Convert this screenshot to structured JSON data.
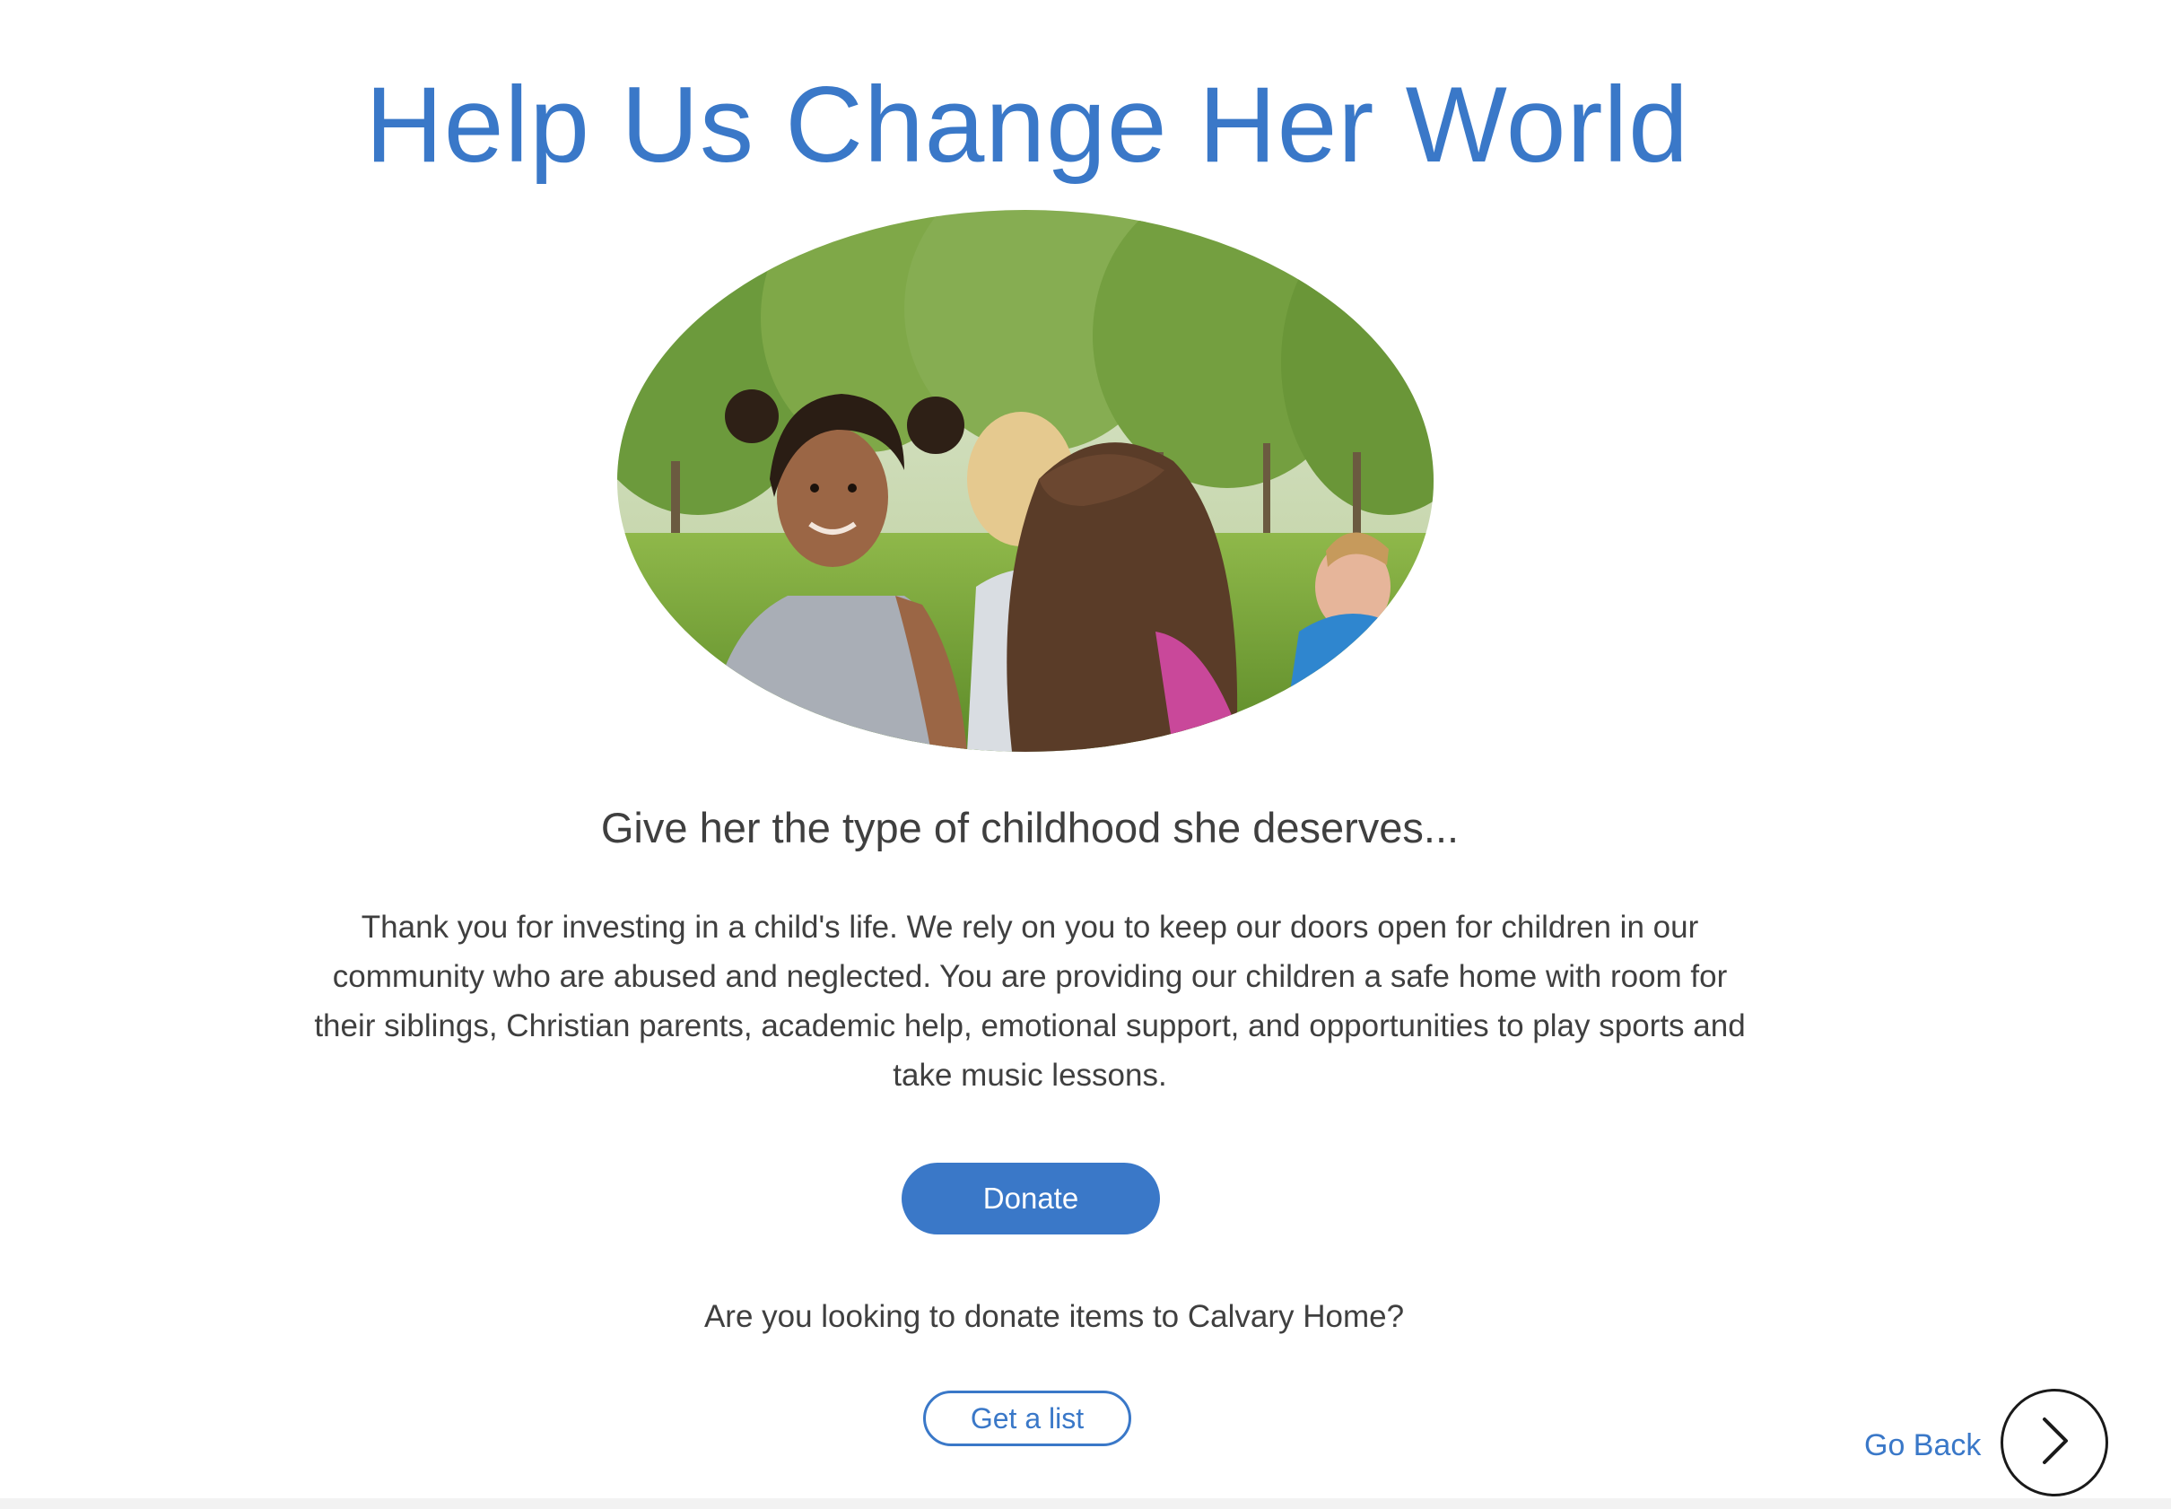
{
  "page": {
    "title": "Help Us Change Her World",
    "subtitle": "Give her the type of childhood she deserves...",
    "body": "Thank you for investing in a child's life. We rely on you to keep our doors open for children in our community who are abused and neglected. You are providing our children a safe home with room for their siblings, Christian parents, academic help, emotional support, and opportunities to play sports and take music lessons.",
    "question": "Are you looking to donate items to Calvary Home?"
  },
  "buttons": {
    "donate_label": "Donate",
    "get_list_label": "Get a list"
  },
  "nav": {
    "go_back_label": "Go Back",
    "go_back_icon": "chevron-right-icon"
  },
  "photo": {
    "subject": "children-sitting-in-park-photo"
  },
  "colors": {
    "accent": "#3a78c8",
    "text": "#3f3f3f",
    "background": "#ffffff"
  }
}
